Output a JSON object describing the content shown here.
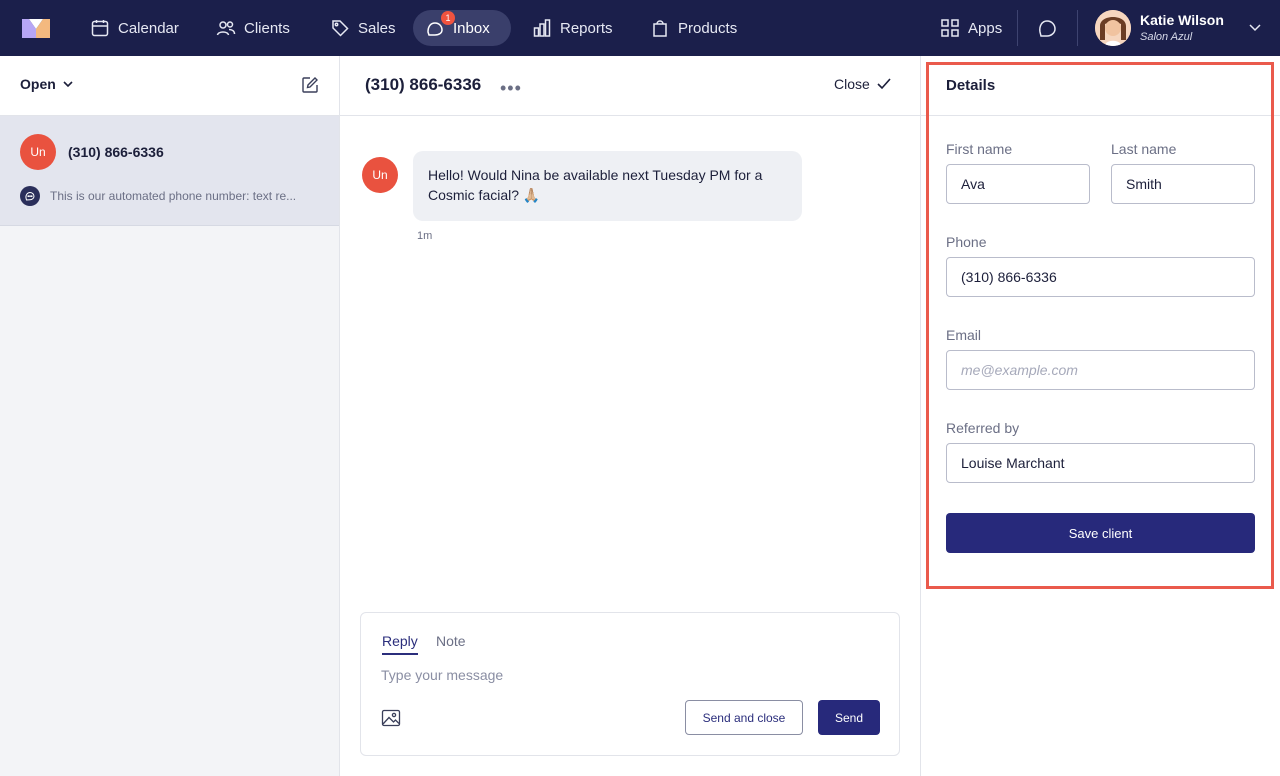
{
  "nav": {
    "items": [
      {
        "label": "Calendar",
        "icon": "calendar-icon"
      },
      {
        "label": "Clients",
        "icon": "users-icon"
      },
      {
        "label": "Sales",
        "icon": "tag-icon"
      },
      {
        "label": "Inbox",
        "icon": "inbox-icon",
        "badge": "1",
        "active": true
      },
      {
        "label": "Reports",
        "icon": "bar-chart-icon"
      },
      {
        "label": "Products",
        "icon": "shopping-bag-icon"
      }
    ],
    "apps_label": "Apps",
    "user": {
      "name": "Katie Wilson",
      "salon": "Salon Azul"
    }
  },
  "conversations": {
    "filter_label": "Open",
    "items": [
      {
        "avatar": "Un",
        "title": "(310) 866-6336",
        "preview": "This is our automated phone number: text re..."
      }
    ]
  },
  "thread": {
    "title": "(310) 866-6336",
    "close_label": "Close",
    "messages": [
      {
        "avatar": "Un",
        "text": "Hello! Would Nina be available next Tuesday PM for a Cosmic facial? 🙏🏼",
        "time": "1m"
      }
    ],
    "composer": {
      "tabs": [
        "Reply",
        "Note"
      ],
      "placeholder": "Type your message",
      "send_close_label": "Send and close",
      "send_label": "Send"
    }
  },
  "details": {
    "title": "Details",
    "first_name_label": "First name",
    "first_name": "Ava",
    "last_name_label": "Last name",
    "last_name": "Smith",
    "phone_label": "Phone",
    "phone": "(310) 866-6336",
    "email_label": "Email",
    "email": "",
    "email_placeholder": "me@example.com",
    "referred_label": "Referred by",
    "referred_by": "Louise Marchant",
    "save_label": "Save client"
  },
  "colors": {
    "nav_bg": "#1b1f4b",
    "primary": "#27297b",
    "avatar": "#e9523f",
    "highlight": "#ea5a4c"
  }
}
